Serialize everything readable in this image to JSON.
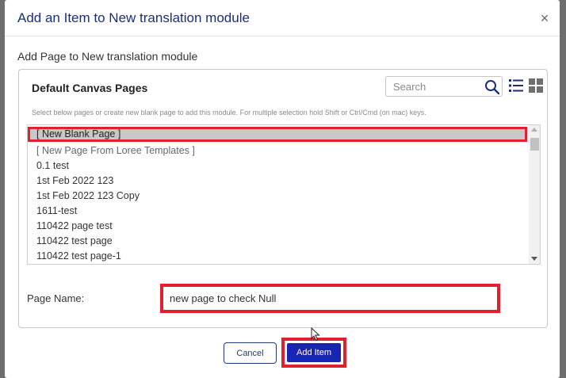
{
  "dialog": {
    "title": "Add an Item to New translation module",
    "close_label": "×",
    "section_label": "Add Page to New translation module"
  },
  "panel": {
    "title": "Default Canvas Pages",
    "search": {
      "placeholder": "Search",
      "value": ""
    },
    "icons": [
      "search-icon",
      "list-view-icon",
      "grid-view-icon"
    ],
    "help_text": "Select below pages or create new blank page to add this module. For multiple selection hold Shift or Ctrl/Cmd (on mac) keys.",
    "pages": [
      "[ New Blank Page ]",
      "[ New Page From Loree Templates ]",
      "0.1 test",
      "1st Feb 2022 123",
      "1st Feb 2022 123 Copy",
      "1611-test",
      "110422 page test",
      "110422 test page",
      "110422 test page-1"
    ],
    "selected_page": "[ New Blank Page ]"
  },
  "page_name": {
    "label": "Page Name:",
    "value": "new page to check Null"
  },
  "footer": {
    "cancel_label": "Cancel",
    "add_label": "Add Item"
  },
  "colors": {
    "title": "#1a2f7a",
    "primary_button": "#1825b3",
    "highlight": "#e0202f",
    "selected_row": "#c8c8c8"
  }
}
